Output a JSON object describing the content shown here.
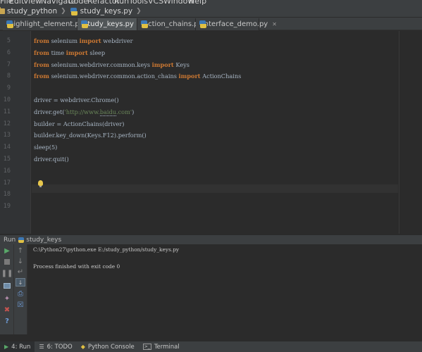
{
  "menu": [
    "File",
    "Edit",
    "View",
    "Navigate",
    "Code",
    "Refactor",
    "Run",
    "Tools",
    "VCS",
    "Window",
    "Help"
  ],
  "breadcrumb": {
    "project": "study_python",
    "file": "study_keys.py"
  },
  "tabs": [
    {
      "label": "highlight_element.py",
      "active": false
    },
    {
      "label": "study_keys.py",
      "active": true
    },
    {
      "label": "action_chains.py",
      "active": false
    },
    {
      "label": "interface_demo.py",
      "active": false
    }
  ],
  "editor": {
    "line_numbers": [
      "5",
      "6",
      "7",
      "8",
      "9",
      "10",
      "11",
      "12",
      "13",
      "14",
      "15",
      "16",
      "17",
      "18",
      "19"
    ],
    "lines": [
      [
        {
          "t": "from",
          "c": "kw"
        },
        {
          "t": " selenium ",
          "c": ""
        },
        {
          "t": "import",
          "c": "kw"
        },
        {
          "t": " webdriver",
          "c": ""
        }
      ],
      [
        {
          "t": "from",
          "c": "kw"
        },
        {
          "t": " time ",
          "c": ""
        },
        {
          "t": "import",
          "c": "kw"
        },
        {
          "t": " sleep",
          "c": ""
        }
      ],
      [
        {
          "t": "from",
          "c": "kw"
        },
        {
          "t": " selenium.webdriver.common.keys ",
          "c": ""
        },
        {
          "t": "import",
          "c": "kw"
        },
        {
          "t": " Keys",
          "c": ""
        }
      ],
      [
        {
          "t": "from",
          "c": "kw"
        },
        {
          "t": " selenium.webdriver.common.action_chains ",
          "c": ""
        },
        {
          "t": "import",
          "c": "kw"
        },
        {
          "t": " ActionChains",
          "c": ""
        }
      ],
      [],
      [
        {
          "t": "driver = webdriver.Chrome()",
          "c": ""
        }
      ],
      [
        {
          "t": "driver.get(",
          "c": ""
        },
        {
          "t": "'http://www.",
          "c": "str"
        },
        {
          "t": "baidu",
          "c": "str u"
        },
        {
          "t": ".com'",
          "c": "str"
        },
        {
          "t": ")",
          "c": ""
        }
      ],
      [
        {
          "t": "builder = ActionChains(driver)",
          "c": ""
        }
      ],
      [
        {
          "t": "builder.key_down(Keys.F12).perform()",
          "c": ""
        }
      ],
      [
        {
          "t": "sleep(5)",
          "c": ""
        }
      ],
      [
        {
          "t": "driver.quit()",
          "c": ""
        }
      ],
      [],
      [],
      [],
      []
    ]
  },
  "run_panel": {
    "label": "Run",
    "config": "study_keys",
    "console": [
      "C:\\Python27\\python.exe E:/study_python/study_keys.py",
      "",
      "Process finished with exit code 0"
    ]
  },
  "bottom_tabs": [
    {
      "label": "4: Run",
      "icon": "run-icon",
      "active": true
    },
    {
      "label": "6: TODO",
      "icon": "todo-icon",
      "active": false
    },
    {
      "label": "Python Console",
      "icon": "python-console-icon",
      "active": false
    },
    {
      "label": "Terminal",
      "icon": "terminal-icon",
      "active": false
    }
  ],
  "colors": {
    "keyword": "#cc7832",
    "string": "#6a8759",
    "text": "#a9b7c6",
    "run_green": "#59a869",
    "stop_red": "#c75450"
  }
}
